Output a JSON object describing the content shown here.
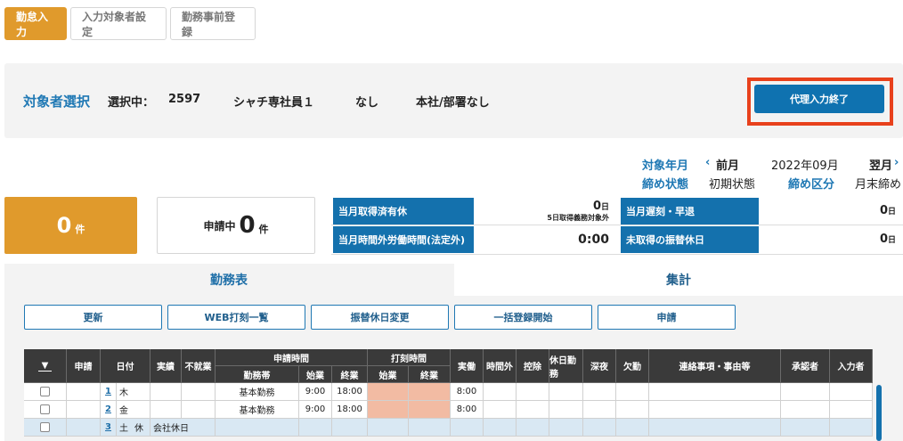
{
  "tabs": {
    "attendance_input": "勤怠入力",
    "target_settings": "入力対象者設定",
    "pre_registration": "勤務事前登録"
  },
  "selection": {
    "title": "対象者選択",
    "selected_label": "選択中：",
    "employee_id": "2597",
    "employee_name": "シャチ専社員１",
    "status": "なし",
    "department": "本社/部署なし",
    "proxy_end_button": "代理入力終了"
  },
  "period": {
    "target_label": "対象年月",
    "prev_label": "前月",
    "month": "2022年09月",
    "next_label": "翌月",
    "closing_status_label": "締め状態",
    "closing_status": "初期状態",
    "closing_type_label": "締め区分",
    "closing_type": "月末締め"
  },
  "summary": {
    "count": "0",
    "count_unit": "件",
    "pending_label": "申請中",
    "pending_count": "0",
    "pending_unit": "件",
    "stats": {
      "paid_leave_label": "当月取得済有休",
      "paid_leave_value": "0",
      "paid_leave_unit": "日",
      "paid_leave_note": "5日取得義務対象外",
      "overtime_label": "当月時間外労働時間(法定外)",
      "overtime_value": "0:00",
      "late_label": "当月遅刻・早退",
      "late_value": "0",
      "late_unit": "日",
      "untaken_label": "未取得の振替休日",
      "untaken_value": "0",
      "untaken_unit": "日"
    }
  },
  "view_tabs": {
    "schedule": "勤務表",
    "totals": "集計"
  },
  "actions": {
    "update": "更新",
    "web_punch": "WEB打刻一覧",
    "change_holiday": "振替休日変更",
    "bulk_register": "一括登録開始",
    "apply": "申請"
  },
  "table": {
    "headers": {
      "select": "▼",
      "apply": "申請",
      "date": "日付",
      "actual": "実績",
      "no_work": "不就業",
      "applied_time": "申請時間",
      "work_zone": "勤務帯",
      "start": "始業",
      "end": "終業",
      "punch_time": "打刻時間",
      "punch_start": "始業",
      "punch_end": "終業",
      "real_work": "実働",
      "overtime": "時間外",
      "deduction": "控除",
      "holiday_work": "休日勤務",
      "late_night": "深夜",
      "absence": "欠勤",
      "notes": "連絡事項・事由等",
      "approver": "承認者",
      "entered_by": "入力者"
    },
    "rows": [
      {
        "day": "1",
        "weekday": "木",
        "work_zone": "基本勤務",
        "start": "9:00",
        "end": "18:00",
        "real_work": "8:00"
      },
      {
        "day": "2",
        "weekday": "金",
        "work_zone": "基本勤務",
        "start": "9:00",
        "end": "18:00",
        "real_work": "8:00"
      },
      {
        "day": "3",
        "weekday": "土",
        "holiday": "休",
        "holiday_name": "会社休日"
      }
    ]
  },
  "colors": {
    "accent_orange": "#e09a2c",
    "primary_blue": "#1471ad",
    "highlight_red": "#e8411c",
    "punch_missing": "#f2bba3",
    "weekend_row": "#d9e8f3"
  }
}
